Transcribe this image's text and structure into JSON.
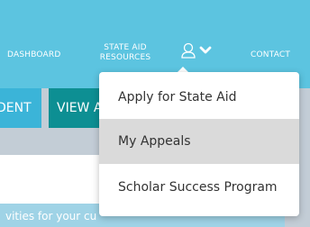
{
  "nav": {
    "dashboard": "DASHBOARD",
    "state_aid_line1": "STATE AID",
    "state_aid_line2": "RESOURCES",
    "account_icon": "user-icon",
    "chevron_icon": "chevron-down-icon",
    "contact": "CONTACT"
  },
  "buttons": {
    "student": "DENT",
    "view": "VIEW A"
  },
  "card": {
    "band_text": "vities for your cu"
  },
  "dropdown": {
    "items": [
      {
        "label": "Apply for State Aid"
      },
      {
        "label": "My Appeals"
      },
      {
        "label": "Scholar Success Program"
      }
    ]
  },
  "colors": {
    "nav_bg": "#5cc4e0",
    "button_light": "#3bb4d8",
    "button_dark": "#0d8f93",
    "page_bg": "#c3cdd6",
    "hover_bg": "#dadada"
  }
}
